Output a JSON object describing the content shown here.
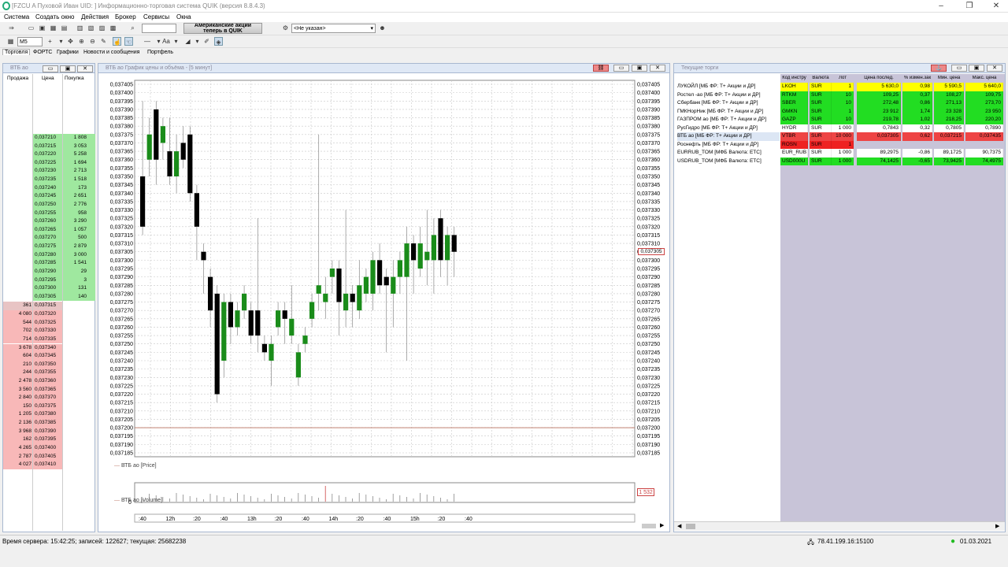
{
  "window": {
    "title": "[FZCU    A Пуховой Иван UID:    ] Информационно-торговая система QUIK (версия 8.8.4.3)"
  },
  "menu": [
    "Система",
    "Создать окно",
    "Действия",
    "Брокер",
    "Сервисы",
    "Окна"
  ],
  "toolbar": {
    "banner": "Американские акции теперь в QUIK",
    "account_select": "<Не указан>",
    "interval": "M5",
    "font_label": "Aa"
  },
  "tabs": [
    "Торговля",
    "ФОРТС",
    "Графики",
    "Новости и сообщения",
    "Портфель"
  ],
  "orderbook": {
    "title": "ВТБ ао",
    "headers": [
      "Продажа",
      "Цена",
      "Покупка"
    ],
    "buy": [
      [
        "0,037210",
        "1 808"
      ],
      [
        "0,037215",
        "3 053"
      ],
      [
        "0,037220",
        "5 258"
      ],
      [
        "0,037225",
        "1 694"
      ],
      [
        "0,037230",
        "2 713"
      ],
      [
        "0,037235",
        "1 518"
      ],
      [
        "0,037240",
        "173"
      ],
      [
        "0,037245",
        "2 651"
      ],
      [
        "0,037250",
        "2 776"
      ],
      [
        "0,037255",
        "958"
      ],
      [
        "0,037260",
        "3 290"
      ],
      [
        "0,037265",
        "1 057"
      ],
      [
        "0,037270",
        "500"
      ],
      [
        "0,037275",
        "2 879"
      ],
      [
        "0,037280",
        "3 000"
      ],
      [
        "0,037285",
        "1 541"
      ],
      [
        "0,037290",
        "29"
      ],
      [
        "0,037295",
        "3"
      ],
      [
        "0,037300",
        "131"
      ],
      [
        "0,037305",
        "140"
      ]
    ],
    "sell": [
      [
        "361",
        "0,037315"
      ],
      [
        "4 080",
        "0,037320"
      ],
      [
        "544",
        "0,037325"
      ],
      [
        "702",
        "0,037330"
      ],
      [
        "714",
        "0,037335"
      ],
      [
        "3 678",
        "0,037340"
      ],
      [
        "604",
        "0,037345"
      ],
      [
        "210",
        "0,037350"
      ],
      [
        "244",
        "0,037355"
      ],
      [
        "2 478",
        "0,037360"
      ],
      [
        "3 560",
        "0,037365"
      ],
      [
        "2 840",
        "0,037370"
      ],
      [
        "150",
        "0,037375"
      ],
      [
        "1 205",
        "0,037380"
      ],
      [
        "2 136",
        "0,037385"
      ],
      [
        "3 968",
        "0,037390"
      ],
      [
        "162",
        "0,037395"
      ],
      [
        "4 265",
        "0,037400"
      ],
      [
        "2 787",
        "0,037405"
      ],
      [
        "4 027",
        "0,037410"
      ]
    ]
  },
  "chart": {
    "title": "ВТБ ао График цены и объёма - [5 минут]",
    "price_legend": "ВТБ ао [Price]",
    "volume_legend": "ВТБ ао [Volume]",
    "current_price_label": "0,037305",
    "volume_label": "1 532",
    "volume_zero": "0",
    "y_ticks": [
      "0,037405",
      "0,037400",
      "0,037395",
      "0,037390",
      "0,037385",
      "0,037380",
      "0,037375",
      "0,037370",
      "0,037365",
      "0,037360",
      "0,037355",
      "0,037350",
      "0,037345",
      "0,037340",
      "0,037335",
      "0,037330",
      "0,037325",
      "0,037320",
      "0,037315",
      "0,037310",
      "0,037305",
      "0,037300",
      "0,037295",
      "0,037290",
      "0,037285",
      "0,037280",
      "0,037275",
      "0,037270",
      "0,037265",
      "0,037260",
      "0,037255",
      "0,037250",
      "0,037245",
      "0,037240",
      "0,037235",
      "0,037230",
      "0,037225",
      "0,037220",
      "0,037215",
      "0,037210",
      "0,037205",
      "0,037200",
      "0,037195",
      "0,037190",
      "0,037185"
    ],
    "time_ticks": [
      ":40",
      "12h",
      ":20",
      ":40",
      "13h",
      ":20",
      ":40",
      "14h",
      ":20",
      ":40",
      "15h",
      ":20",
      ":40"
    ],
    "colors": {
      "up": "#1a8c1a",
      "down": "#000000",
      "grid": "#c8c8c8",
      "level": "#c08070"
    }
  },
  "trades": {
    "title": "Текущие торги",
    "headers": [
      "Код инстру",
      "Валюта",
      "Лот",
      "Цена послед.",
      "% измен.зак",
      "Мин. цена",
      "Макс. цена"
    ],
    "rows": [
      {
        "name": "ЛУКОЙЛ [МБ ФР: Т+ Акции и ДР]",
        "code": "LKOH",
        "cur": "SUR",
        "lot": "1",
        "last": "5 630,0",
        "chg": "0,98",
        "min": "5 590,5",
        "max": "5 640,0",
        "bg": "#ffff00"
      },
      {
        "name": "Ростел -ао [МБ ФР: Т+ Акции и ДР]",
        "code": "RTKM",
        "cur": "SUR",
        "lot": "10",
        "last": "109,25",
        "chg": "0,37",
        "min": "108,27",
        "max": "109,75",
        "bg": "#22dd22"
      },
      {
        "name": "Сбербанк [МБ ФР: Т+ Акции и ДР]",
        "code": "SBER",
        "cur": "SUR",
        "lot": "10",
        "last": "272,48",
        "chg": "0,86",
        "min": "271,13",
        "max": "273,70",
        "bg": "#22dd22"
      },
      {
        "name": "ГМКНорНик [МБ ФР: Т+ Акции и ДР]",
        "code": "GMKN",
        "cur": "SUR",
        "lot": "1",
        "last": "23 912",
        "chg": "1,74",
        "min": "23 328",
        "max": "23 950",
        "bg": "#22dd22"
      },
      {
        "name": "ГАЗПРОМ ао [МБ ФР: Т+ Акции и ДР]",
        "code": "GAZP",
        "cur": "SUR",
        "lot": "10",
        "last": "219,78",
        "chg": "1,02",
        "min": "218,25",
        "max": "220,20",
        "bg": "#22dd22"
      },
      {
        "name": "РусГидро [МБ ФР: Т+ Акции и ДР]",
        "code": "HYDR",
        "cur": "SUR",
        "lot": "1 000",
        "last": "0,7843",
        "chg": "0,32",
        "min": "0,7805",
        "max": "0,7890",
        "bg": "#ffffff"
      },
      {
        "name": "ВТБ ао [МБ ФР: Т+ Акции и ДР]",
        "code": "VTBR",
        "cur": "SUR",
        "lot": "10 000",
        "last": "0,037305",
        "chg": "0,62",
        "min": "0,037215",
        "max": "0,037435",
        "bg": "#ee4444"
      },
      {
        "name": "Роснефть [МБ ФР: Т+ Акции и ДР]",
        "code": "ROSN",
        "cur": "SUR",
        "lot": "1",
        "last": "",
        "chg": "",
        "min": "",
        "max": "",
        "bg": "#ee2222"
      },
      {
        "name": "EURRUB_TOM [МФБ Валюта: ETC]",
        "code": "EUR_RUB",
        "cur": "SUR",
        "lot": "1 000",
        "last": "89,2975",
        "chg": "-0,86",
        "min": "89,1725",
        "max": "90,7375",
        "bg": "#ffffff"
      },
      {
        "name": "USDRUB_TOM [МФБ Валюта: ETC]",
        "code": "USD000U",
        "cur": "SUR",
        "lot": "1 000",
        "last": "74,1425",
        "chg": "-0,65",
        "min": "73,9425",
        "max": "74,4975",
        "bg": "#22dd22"
      }
    ]
  },
  "status": {
    "server": "Время сервера: 15:42:25; записей: 122627; текущая: 25682238",
    "ip": "78.41.199.16:15100",
    "date": "01.03.2021"
  }
}
